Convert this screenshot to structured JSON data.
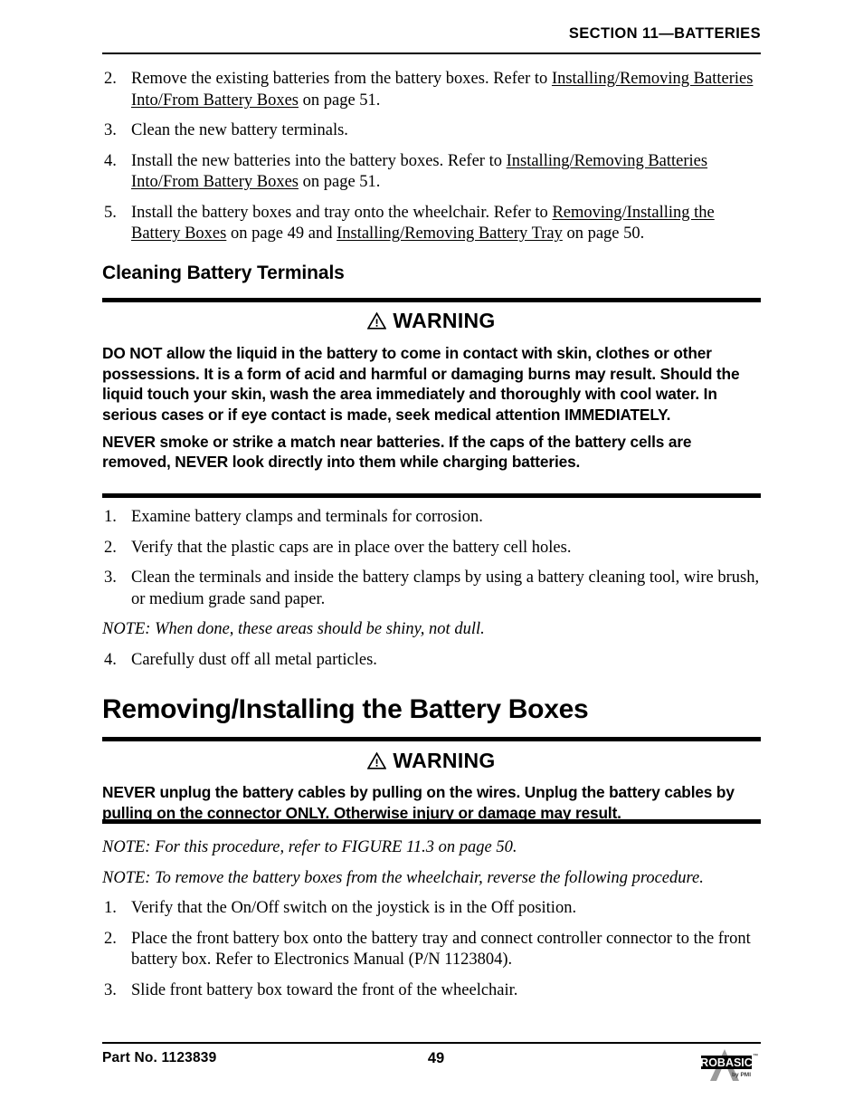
{
  "header": {
    "section_title": "SECTION 11—BATTERIES"
  },
  "top_list": [
    {
      "num": "2.",
      "segments": [
        {
          "text": "Remove the existing batteries from the battery boxes. Refer to ",
          "style": "plain"
        },
        {
          "text": "Installing/Removing Batteries Into/From Battery Boxes",
          "style": "underline"
        },
        {
          "text": " on page 51.",
          "style": "plain"
        }
      ]
    },
    {
      "num": "3.",
      "segments": [
        {
          "text": "Clean the new battery terminals.",
          "style": "plain"
        }
      ]
    },
    {
      "num": "4.",
      "segments": [
        {
          "text": "Install the new batteries into the battery boxes. Refer to ",
          "style": "plain"
        },
        {
          "text": "Installing/Removing Batteries Into/From Battery Boxes",
          "style": "underline"
        },
        {
          "text": " on page 51.",
          "style": "plain"
        }
      ]
    },
    {
      "num": "5.",
      "segments": [
        {
          "text": "Install the battery boxes and tray onto the wheelchair. Refer to ",
          "style": "plain"
        },
        {
          "text": "Removing/Installing the Battery Boxes",
          "style": "underline"
        },
        {
          "text": " on page 49 and ",
          "style": "plain"
        },
        {
          "text": "Installing/Removing Battery Tray",
          "style": "underline"
        },
        {
          "text": " on page 50.",
          "style": "plain"
        }
      ]
    }
  ],
  "subheading_cleaning": "Cleaning Battery Terminals",
  "warning_one": {
    "label": "WARNING",
    "icon": "warning-triangle-icon",
    "paragraphs": [
      [
        {
          "text": "DO NOT",
          "style": "bold"
        },
        {
          "text": " allow the liquid in the battery to come in contact with skin, clothes or other possessions. It is a form of acid and harmful or damaging burns may result. Should the liquid touch your skin, wash the area immediately and thoroughly with cool water. In serious cases or if eye contact is made, seek medical attention ",
          "style": "plain"
        },
        {
          "text": "IMMEDIATELY.",
          "style": "bold"
        }
      ],
      [
        {
          "text": "NEVER",
          "style": "bold"
        },
        {
          "text": " smoke or strike a match near batteries. If the caps of the battery cells are removed, ",
          "style": "plain"
        },
        {
          "text": "NEVER",
          "style": "bold"
        },
        {
          "text": " look directly into them while charging batteries.",
          "style": "plain"
        }
      ]
    ]
  },
  "cleaning_steps": [
    {
      "type": "item",
      "num": "1.",
      "text": "Examine battery clamps and terminals for corrosion."
    },
    {
      "type": "item",
      "num": "2.",
      "text": "Verify that the plastic caps are in place over the battery cell holes."
    },
    {
      "type": "item",
      "num": "3.",
      "text": "Clean the terminals and inside the battery clamps by using a battery cleaning tool, wire brush, or medium grade sand paper."
    },
    {
      "type": "note",
      "text": "NOTE: When done, these areas should be shiny, not dull."
    },
    {
      "type": "item",
      "num": "4.",
      "text": "Carefully dust off all metal particles."
    }
  ],
  "heading_removing": "Removing/Installing the Battery Boxes",
  "warning_two": {
    "label": "WARNING",
    "icon": "warning-triangle-icon",
    "paragraphs": [
      [
        {
          "text": "NEVER",
          "style": "bold"
        },
        {
          "text": " unplug the battery cables by pulling on the wires. Unplug the battery cables by pulling on the connector ",
          "style": "plain"
        },
        {
          "text": "ONLY.",
          "style": "bold"
        },
        {
          "text": " Otherwise injury or damage may result.",
          "style": "plain"
        }
      ]
    ]
  },
  "removing_steps": [
    {
      "type": "note",
      "text": "NOTE: For this procedure, refer to FIGURE 11.3 on page 50."
    },
    {
      "type": "note",
      "text": "NOTE: To remove the battery boxes from the wheelchair, reverse the following procedure."
    },
    {
      "type": "item",
      "num": "1.",
      "text": "Verify that the On/Off switch on the joystick is in the Off position."
    },
    {
      "type": "item",
      "num": "2.",
      "text": "Place the front battery box onto the battery tray and connect controller connector to the front battery box. Refer to Electronics Manual (P/N 1123804)."
    },
    {
      "type": "item",
      "num": "3.",
      "text": "Slide front battery box toward the front of the wheelchair."
    }
  ],
  "footer": {
    "part_no": "Part No. 1123839",
    "page_number": "49",
    "logo_main": "PROBASICS",
    "logo_sub": "by PMI"
  },
  "colors": {
    "text": "#000000",
    "rule": "#000000",
    "logo_gray": "#9a9a9a",
    "background": "#ffffff"
  }
}
